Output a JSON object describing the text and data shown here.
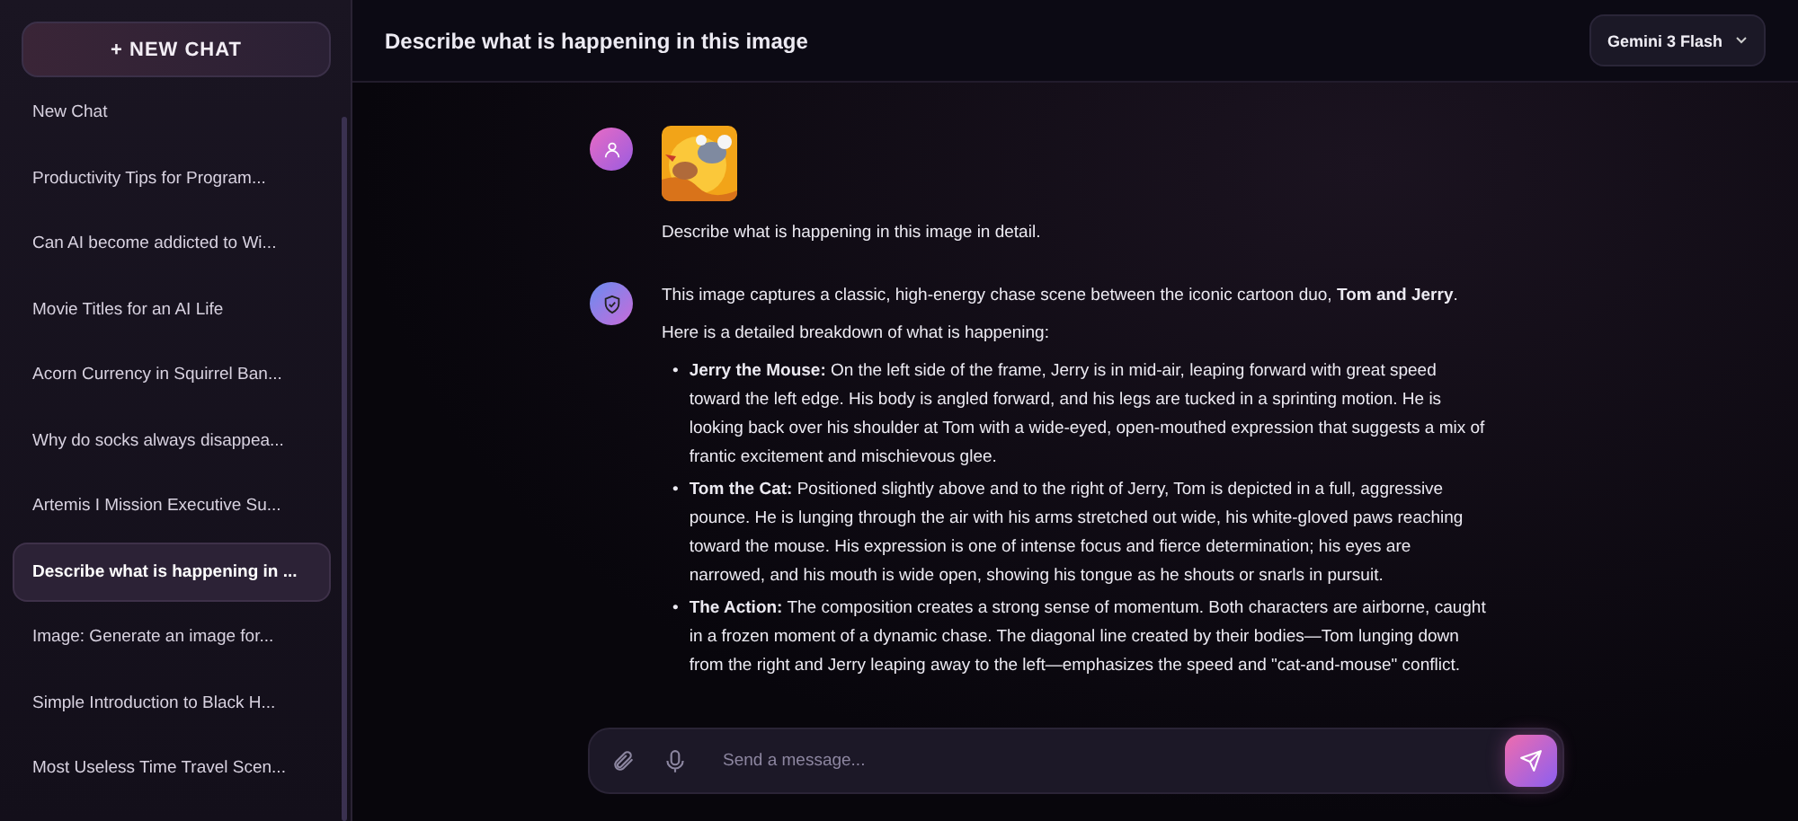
{
  "sidebar": {
    "new_chat_button": "+ NEW CHAT",
    "items": [
      {
        "label": "New Chat",
        "selected": false
      },
      {
        "label": "Productivity Tips for Program...",
        "selected": false
      },
      {
        "label": "Can AI become addicted to Wi...",
        "selected": false
      },
      {
        "label": "Movie Titles for an AI Life",
        "selected": false
      },
      {
        "label": "Acorn Currency in Squirrel Ban...",
        "selected": false
      },
      {
        "label": "Why do socks always disappea...",
        "selected": false
      },
      {
        "label": "Artemis I Mission Executive Su...",
        "selected": false
      },
      {
        "label": "Describe what is happening in ...",
        "selected": true
      },
      {
        "label": "Image: Generate an image for...",
        "selected": false
      },
      {
        "label": "Simple Introduction to Black H...",
        "selected": false
      },
      {
        "label": "Most Useless Time Travel Scen...",
        "selected": false
      }
    ]
  },
  "header": {
    "title": "Describe what is happening in this image",
    "model": "Gemini 3 Flash"
  },
  "messages": [
    {
      "kind": "user",
      "text": "Describe what is happening in this image in detail."
    },
    {
      "kind": "assistant",
      "bullet_marker": "•",
      "paragraphs": [
        "This image captures a classic, high-energy chase scene between the iconic cartoon duo, **Tom and Jerry**.",
        "Here is a detailed breakdown of what is happening:"
      ],
      "bullets": [
        "**Jerry the Mouse:** On the left side of the frame, Jerry is in mid-air, leaping forward with great speed toward the left edge. His body is angled forward, and his legs are tucked in a sprinting motion. He is looking back over his shoulder at Tom with a wide-eyed, open-mouthed expression that suggests a mix of frantic excitement and mischievous glee.",
        "**Tom the Cat:** Positioned slightly above and to the right of Jerry, Tom is depicted in a full, aggressive pounce. He is lunging through the air with his arms stretched out wide, his white-gloved paws reaching toward the mouse. His expression is one of intense focus and fierce determination; his eyes are narrowed, and his mouth is wide open, showing his tongue as he shouts or snarls in pursuit.",
        "**The Action:** The composition creates a strong sense of momentum. Both characters are airborne, caught in a frozen moment of a dynamic chase. The diagonal line created by their bodies—Tom lunging down from the right and Jerry leaping away to the left—emphasizes the speed and \"cat-and-mouse\" conflict."
      ]
    }
  ],
  "composer": {
    "placeholder": "Send a message..."
  }
}
